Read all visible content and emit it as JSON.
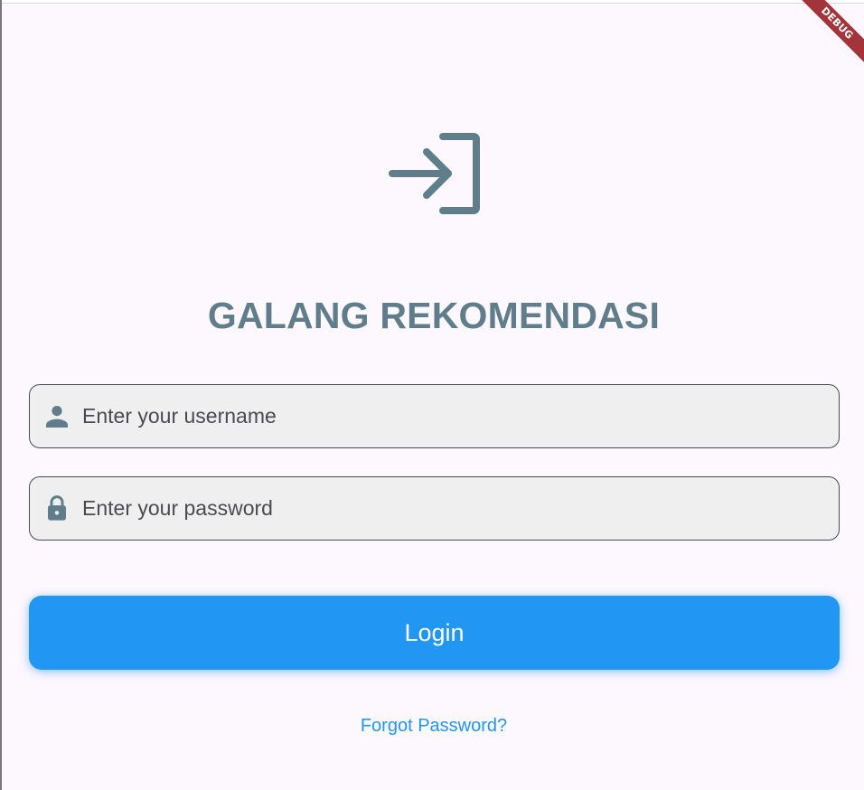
{
  "debug_banner": {
    "label": "DEBUG",
    "color": "#A3353A"
  },
  "header": {
    "icon": "login-arrow-icon",
    "title": "GALANG REKOMENDASI",
    "title_color": "#5F7D8B"
  },
  "form": {
    "username": {
      "icon": "person-icon",
      "placeholder": "Enter your username",
      "value": ""
    },
    "password": {
      "icon": "lock-icon",
      "placeholder": "Enter your password",
      "value": ""
    },
    "login_label": "Login",
    "forgot_label": "Forgot Password?"
  },
  "colors": {
    "background": "#FDF7FE",
    "primary": "#2196F3",
    "field_fill": "#EFEFEF",
    "icon": "#5F7D8B"
  }
}
